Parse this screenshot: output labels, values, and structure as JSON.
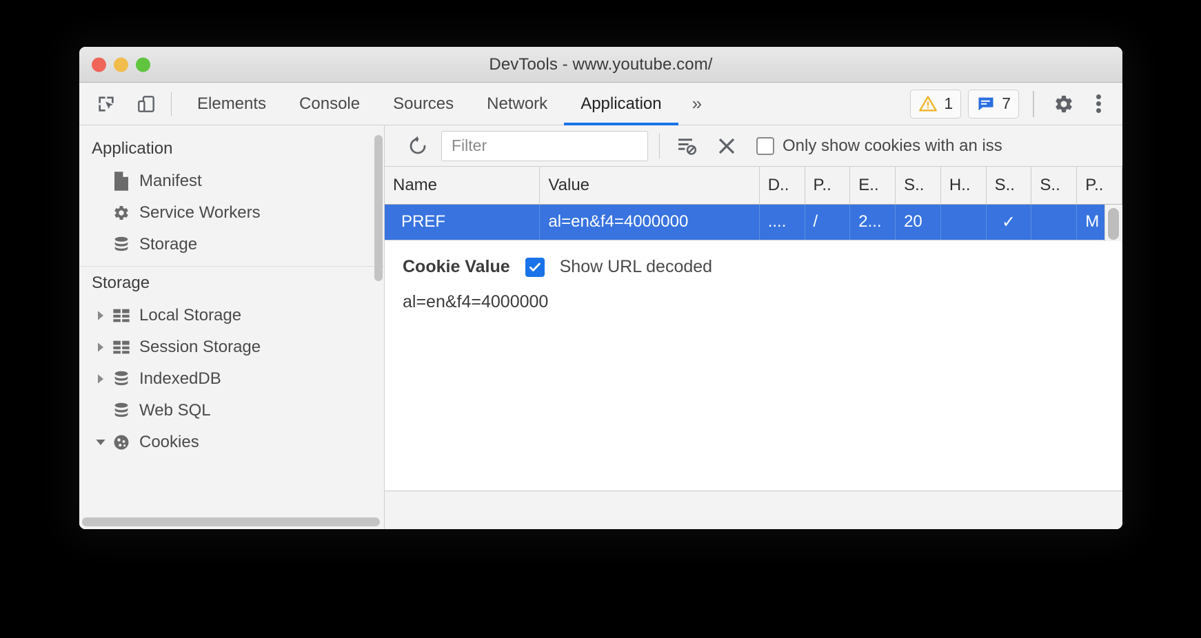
{
  "window": {
    "title": "DevTools - www.youtube.com/",
    "traffic_lights": [
      "close-red",
      "minimize-yellow",
      "maximize-green"
    ]
  },
  "tabstrip": {
    "left_icons": [
      {
        "name": "inspect-element-icon",
        "label": "Inspect element"
      },
      {
        "name": "device-toolbar-icon",
        "label": "Toggle device toolbar"
      }
    ],
    "tabs": [
      {
        "label": "Elements",
        "active": false
      },
      {
        "label": "Console",
        "active": false
      },
      {
        "label": "Sources",
        "active": false
      },
      {
        "label": "Network",
        "active": false
      },
      {
        "label": "Application",
        "active": true
      }
    ],
    "more_tabs_label": "»",
    "warnings": {
      "icon": "warning-triangle-icon",
      "count": "1"
    },
    "messages": {
      "icon": "message-bubble-icon",
      "count": "7"
    },
    "settings_icon": "gear-icon",
    "more_options_icon": "kebab-menu-icon",
    "active_tab_underline_color": "#1a73e8"
  },
  "sidebar": {
    "sections": [
      {
        "title": "Application",
        "items": [
          {
            "label": "Manifest",
            "icon": "document-icon",
            "twisty": "none"
          },
          {
            "label": "Service Workers",
            "icon": "gear-icon",
            "twisty": "none"
          },
          {
            "label": "Storage",
            "icon": "database-icon",
            "twisty": "none"
          }
        ]
      },
      {
        "title": "Storage",
        "items": [
          {
            "label": "Local Storage",
            "icon": "table-icon",
            "twisty": "collapsed"
          },
          {
            "label": "Session Storage",
            "icon": "table-icon",
            "twisty": "collapsed"
          },
          {
            "label": "IndexedDB",
            "icon": "database-icon",
            "twisty": "collapsed"
          },
          {
            "label": "Web SQL",
            "icon": "database-icon",
            "twisty": "none"
          },
          {
            "label": "Cookies",
            "icon": "cookie-icon",
            "twisty": "expanded"
          }
        ]
      }
    ]
  },
  "cookies_toolbar": {
    "refresh_icon": "refresh-icon",
    "filter_placeholder": "Filter",
    "filter_value": "",
    "clear_filtered_icon": "clear-filtered-cookies-icon",
    "clear_all_icon": "clear-all-cookies-x-icon",
    "issues_checkbox": {
      "label": "Only show cookies with an iss",
      "checked": false
    }
  },
  "cookies_table": {
    "columns": [
      "Name",
      "Value",
      "D..",
      "P..",
      "E..",
      "S..",
      "H..",
      "S..",
      "S..",
      "P.."
    ],
    "rows": [
      {
        "selected": true,
        "cells": [
          "PREF",
          "al=en&f4=4000000",
          "....",
          "/",
          "2...",
          "20",
          "",
          "✓",
          "",
          "M"
        ]
      }
    ]
  },
  "cookie_detail": {
    "title": "Cookie Value",
    "show_url_decoded_label": "Show URL decoded",
    "show_url_decoded_checked": true,
    "value": "al=en&f4=4000000"
  },
  "colors": {
    "accent": "#1a73e8",
    "selection": "#3873df",
    "chrome_bg": "#f3f3f3",
    "panel_bg": "#ffffff"
  }
}
